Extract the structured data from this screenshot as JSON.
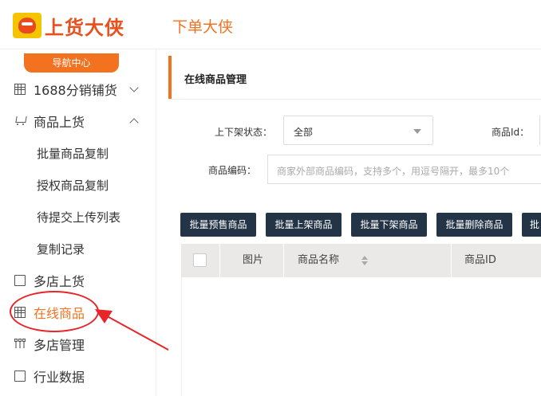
{
  "header": {
    "logo_text": "上货大侠",
    "app_title": "下单大侠"
  },
  "sidebar": {
    "nav_center": "导航中心",
    "items": [
      {
        "label": "1688分销铺货",
        "icon": "grid-icon",
        "chevron": "down"
      },
      {
        "label": "商品上货",
        "icon": "cart-icon",
        "chevron": "up"
      },
      {
        "label": "批量商品复制"
      },
      {
        "label": "授权商品复制"
      },
      {
        "label": "待提交上传列表"
      },
      {
        "label": "复制记录"
      },
      {
        "label": "多店上货",
        "icon": "doc-icon"
      },
      {
        "label": "在线商品",
        "icon": "grid-icon",
        "active": true
      },
      {
        "label": "多店管理",
        "icon": "tree-icon"
      },
      {
        "label": "行业数据",
        "icon": "doc-icon"
      }
    ]
  },
  "main": {
    "panel_title": "在线商品管理",
    "form": {
      "status_label": "上下架状态：",
      "status_value": "全部",
      "product_id_label": "商品Id：",
      "code_label": "商品编码：",
      "code_placeholder": "商家外部商品编码，支持多个，用逗号隔开，最多10个"
    },
    "buttons": [
      "批量预售商品",
      "批量上架商品",
      "批量下架商品",
      "批量删除商品",
      "批"
    ],
    "table": {
      "columns": [
        "图片",
        "商品名称",
        "商品ID"
      ]
    }
  },
  "colors": {
    "accent": "#f27220",
    "button_bg": "#243447",
    "annotation_red": "#e8262a"
  }
}
